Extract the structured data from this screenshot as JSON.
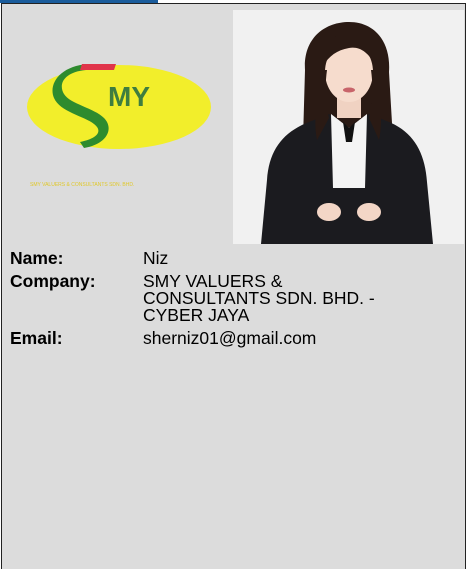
{
  "logo": {
    "monogram": "MY",
    "tagline": "SMY VALUERS & CONSULTANTS SDN. BHD.",
    "colors": {
      "ellipse": "#f2ee2b",
      "swoosh": "#2e8b2e",
      "accent": "#e0344a",
      "text": "#3f7d3f"
    }
  },
  "profile": {
    "fields": [
      {
        "label": "Name:",
        "lines": [
          "Niz"
        ]
      },
      {
        "label": "Company:",
        "lines": [
          "SMY VALUERS &",
          "CONSULTANTS SDN. BHD. -",
          "CYBER JAYA"
        ]
      },
      {
        "label": "Email:",
        "lines": [
          "sherniz01@gmail.com"
        ]
      }
    ]
  }
}
